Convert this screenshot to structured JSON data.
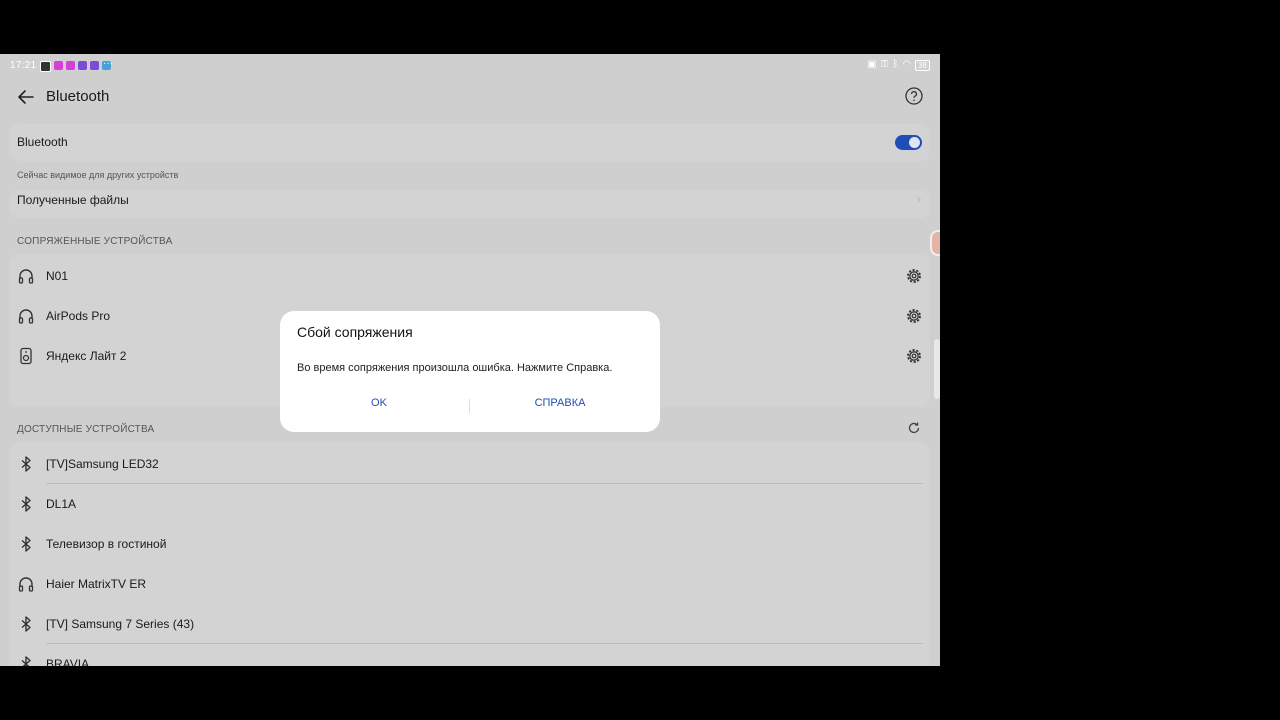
{
  "status_bar": {
    "time": "17:21",
    "battery": "38",
    "more": "···"
  },
  "header": {
    "title": "Bluetooth"
  },
  "bluetooth": {
    "label": "Bluetooth",
    "enabled": true,
    "visibility_hint": "Сейчас видимое для других устройств"
  },
  "received_files": {
    "label": "Полученные файлы"
  },
  "paired": {
    "section_title": "СОПРЯЖЕННЫЕ УСТРОЙСТВА",
    "devices": [
      {
        "name": "N01",
        "icon": "headphones-icon"
      },
      {
        "name": "AirPods Pro",
        "icon": "headphones-icon"
      },
      {
        "name": "Яндекс Лайт 2",
        "icon": "speaker-icon"
      }
    ]
  },
  "available": {
    "section_title": "ДОСТУПНЫЕ УСТРОЙСТВА",
    "devices": [
      {
        "name": "[TV]Samsung LED32",
        "icon": "bluetooth-icon"
      },
      {
        "name": "DL1A",
        "icon": "bluetooth-icon"
      },
      {
        "name": "Телевизор в гостиной",
        "icon": "bluetooth-icon"
      },
      {
        "name": "Haier MatrixTV ER",
        "icon": "headphones-icon"
      },
      {
        "name": "[TV] Samsung 7 Series (43)",
        "icon": "bluetooth-icon"
      },
      {
        "name": "BRAVIA",
        "icon": "bluetooth-icon"
      }
    ]
  },
  "dialog": {
    "title": "Сбой сопряжения",
    "message": "Во время сопряжения произошла ошибка. Нажмите Справка.",
    "ok_label": "OK",
    "help_label": "СПРАВКА"
  },
  "colors": {
    "accent": "#1f4eb8",
    "overlay_bg": "#cfcfcf",
    "dialog_bg": "#ffffff"
  }
}
